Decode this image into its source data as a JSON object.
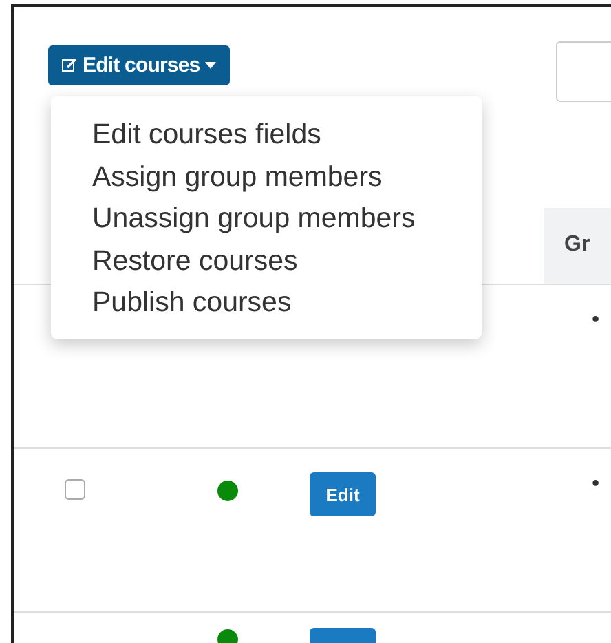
{
  "toolbar": {
    "edit_button": "Edit courses"
  },
  "menu": {
    "items": [
      "Edit courses fields",
      "Assign group members",
      "Unassign group members",
      "Restore courses",
      "Publish courses"
    ]
  },
  "table": {
    "columns": [
      "Gr"
    ],
    "rows": [
      {
        "group": "•"
      },
      {
        "checked": false,
        "color": "#0a8a0a",
        "has_edit": true,
        "edit_label": "Edit",
        "group": "•"
      },
      {
        "color": "#0a8a0a",
        "has_edit": true
      }
    ]
  }
}
